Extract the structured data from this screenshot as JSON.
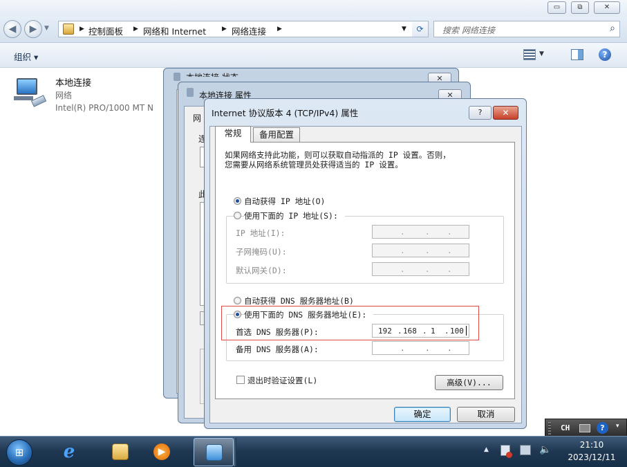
{
  "window": {
    "caption_buttons": [
      "▭",
      "⧉",
      "✕"
    ]
  },
  "address": {
    "breadcrumbs": [
      "控制面板",
      "网络和 Internet",
      "网络连接"
    ],
    "search_placeholder": "搜索 网络连接"
  },
  "command_bar": {
    "organize": "组织 ▾"
  },
  "connection": {
    "name": "本地连接",
    "network": "网络",
    "device": "Intel(R) PRO/1000 MT N"
  },
  "dialogs": {
    "status_title": "本地连接 状态",
    "properties_title": "本地连接 属性",
    "properties_fragments": [
      "网",
      "连",
      "此"
    ]
  },
  "ipv4": {
    "title": "Internet 协议版本 4 (TCP/IPv4) 属性",
    "help_label": "?",
    "close_label": "✕",
    "tabs": [
      "常规",
      "备用配置"
    ],
    "intro_line1": "如果网络支持此功能，则可以获取自动指派的 IP 设置。否则，",
    "intro_line2": "您需要从网络系统管理员处获得适当的 IP 设置。",
    "auto_ip": "自动获得 IP 地址(O)",
    "manual_ip": "使用下面的 IP 地址(S):",
    "ip_label": "IP 地址(I):",
    "mask_label": "子网掩码(U):",
    "gateway_label": "默认网关(D):",
    "auto_dns": "自动获得 DNS 服务器地址(B)",
    "manual_dns": "使用下面的 DNS 服务器地址(E):",
    "preferred_dns_label": "首选 DNS 服务器(P):",
    "preferred_dns": [
      "192",
      "168",
      "1",
      "100"
    ],
    "alternate_dns_label": "备用 DNS 服务器(A):",
    "validate_label": "退出时验证设置(L)",
    "advanced_label": "高级(V)...",
    "ok_label": "确定",
    "cancel_label": "取消",
    "selected_ip_mode": "auto",
    "selected_dns_mode": "manual"
  },
  "language_bar": {
    "label": "CH"
  },
  "taskbar": {
    "time": "21:10",
    "date": "2023/12/11",
    "tray_arrow": "▲"
  },
  "colors": {
    "highlight_border": "#e04848",
    "close_red": "#c8402a",
    "taskbar": "#1e3650"
  }
}
